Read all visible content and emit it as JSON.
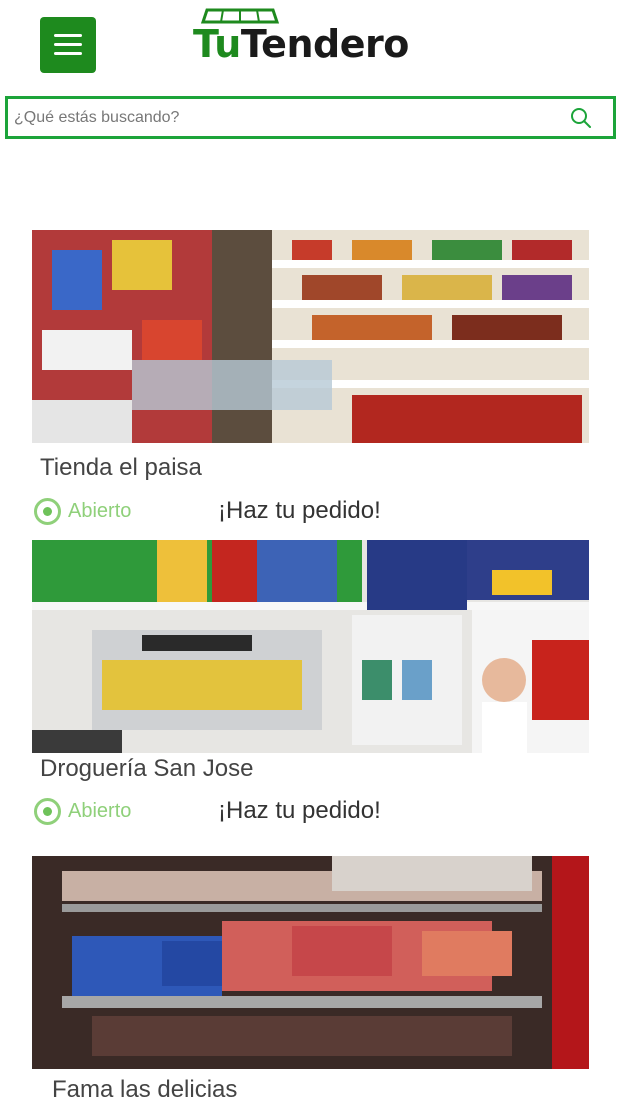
{
  "header": {
    "menu_icon": "hamburger-menu-icon",
    "logo_part1": "Tu",
    "logo_part2": "Tendero",
    "brand_green": "#1e8a1e"
  },
  "search": {
    "placeholder": "¿Qué estás buscando?",
    "icon": "search-icon",
    "border_color": "#1ca43a"
  },
  "stores": [
    {
      "name": "Tienda el paisa",
      "status": "Abierto",
      "cta": "¡Haz tu pedido!",
      "image": "grocery-store-shelves-photo"
    },
    {
      "name": "Droguería San Jose",
      "status": "Abierto",
      "cta": "¡Haz tu pedido!",
      "image": "pharmacy-shelves-photo"
    },
    {
      "name": "Fama las delicias",
      "image": "butcher-meat-display-photo"
    }
  ]
}
